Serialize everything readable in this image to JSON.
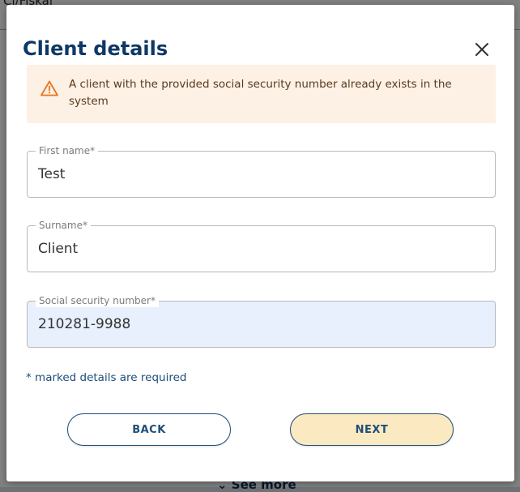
{
  "background": {
    "top_text": "Ci/Fiskal",
    "see_more": "See more"
  },
  "modal": {
    "title": "Client details",
    "close_icon": "close-icon",
    "alert": {
      "icon": "warning-triangle-icon",
      "message": "A client with the provided social security number already exists in the system",
      "color": "#fdf0e4"
    },
    "fields": {
      "first_name": {
        "label": "First name*",
        "value": "Test"
      },
      "surname": {
        "label": "Surname*",
        "value": "Client"
      },
      "ssn": {
        "label": "Social security number*",
        "value": "210281-9988"
      }
    },
    "required_note": "* marked details are required",
    "buttons": {
      "back": "BACK",
      "next": "NEXT"
    }
  },
  "colors": {
    "brand": "#0f3864",
    "warning": "#e8741c",
    "next_button": "#fbeac1"
  }
}
